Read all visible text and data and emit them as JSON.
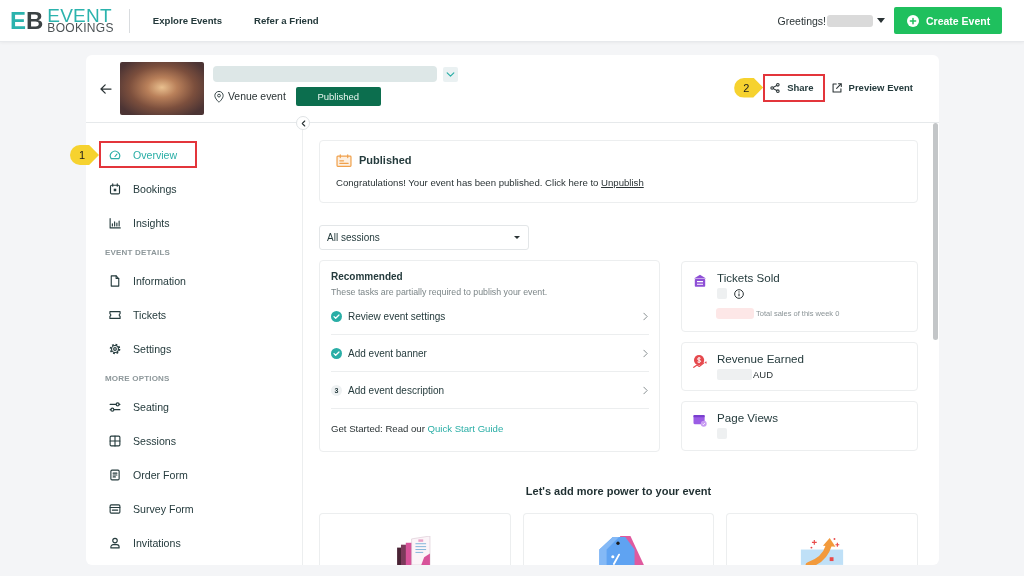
{
  "topbar": {
    "logo": {
      "mark": "EB",
      "word1": "EVENT",
      "word2": "BOOKINGS"
    },
    "nav": [
      "Explore Events",
      "Refer a Friend"
    ],
    "greeting": "Greetings!",
    "create_button": "Create Event"
  },
  "event": {
    "venue_type": "Venue event",
    "status": "Published",
    "actions": [
      {
        "label": "Share",
        "highlighted": true,
        "callout": "2"
      },
      {
        "label": "Preview Event",
        "highlighted": false
      }
    ]
  },
  "sidebar": {
    "groups": [
      {
        "items": [
          {
            "label": "Overview",
            "selected": true,
            "highlighted": true,
            "callout": "1"
          },
          {
            "label": "Bookings",
            "selected": false,
            "highlighted": false
          },
          {
            "label": "Insights",
            "selected": false,
            "highlighted": false
          }
        ]
      },
      {
        "heading": "EVENT DETAILS",
        "items": [
          {
            "label": "Information",
            "selected": false,
            "highlighted": false
          },
          {
            "label": "Tickets",
            "selected": false,
            "highlighted": false
          },
          {
            "label": "Settings",
            "selected": false,
            "highlighted": false
          }
        ]
      },
      {
        "heading": "MORE OPTIONS",
        "items": [
          {
            "label": "Seating",
            "selected": false,
            "highlighted": false
          },
          {
            "label": "Sessions",
            "selected": false,
            "highlighted": false
          },
          {
            "label": "Order Form",
            "selected": false,
            "highlighted": false
          },
          {
            "label": "Survey Form",
            "selected": false,
            "highlighted": false
          },
          {
            "label": "Invitations",
            "selected": false,
            "highlighted": false
          }
        ]
      }
    ]
  },
  "notice": {
    "title": "Published",
    "text": "Congratulations! Your event has been published. Click here to ",
    "link": "Unpublish"
  },
  "session_select": {
    "value": "All sessions"
  },
  "recommended": {
    "title": "Recommended",
    "subtitle": "These tasks are partially required to publish your event.",
    "tasks": [
      {
        "label": "Review event settings",
        "done": true
      },
      {
        "label": "Add event banner",
        "done": true
      },
      {
        "label": "Add event description",
        "done": false,
        "step": "3"
      }
    ],
    "footer": "Get Started: Read our ",
    "footer_link": "Quick Start Guide"
  },
  "stats": [
    {
      "kind": "tickets",
      "title": "Tickets Sold",
      "note": "Total sales of this week 0"
    },
    {
      "kind": "revenue",
      "title": "Revenue Earned",
      "unit": "AUD"
    },
    {
      "kind": "views",
      "title": "Page Views"
    }
  ],
  "promo": {
    "heading": "Let's add more power to your event",
    "cards": [
      {
        "kind": "documents"
      },
      {
        "kind": "discount"
      },
      {
        "kind": "growth"
      }
    ]
  }
}
